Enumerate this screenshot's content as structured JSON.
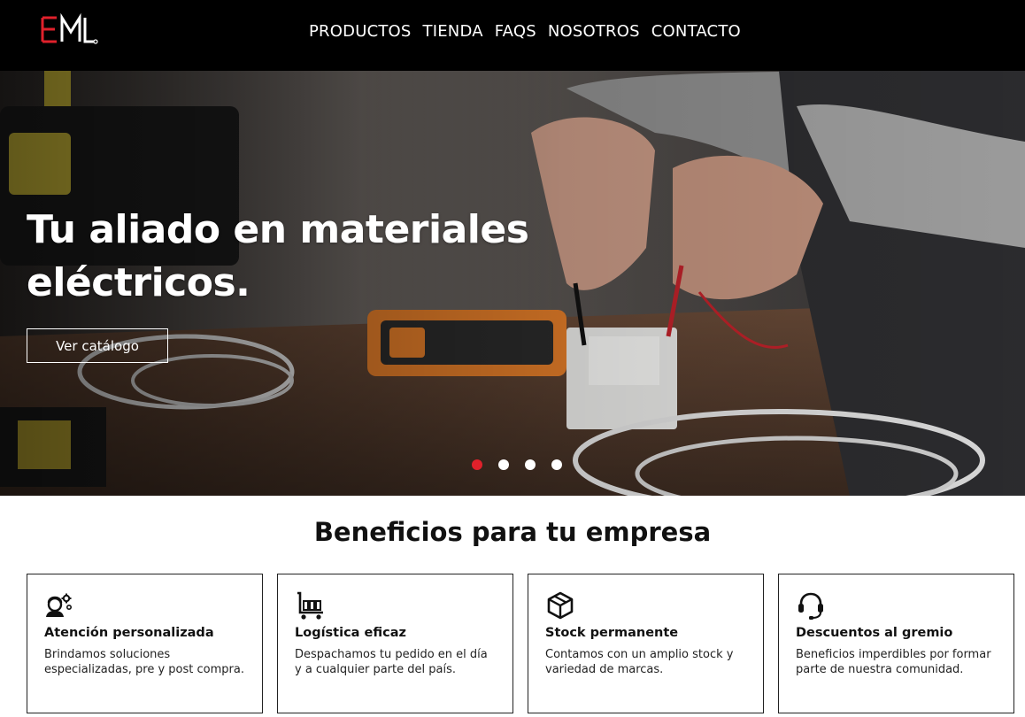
{
  "header": {
    "logo_text": "EML",
    "nav": [
      "PRODUCTOS",
      "TIENDA",
      "FAQS",
      "NOSOTROS",
      "CONTACTO"
    ]
  },
  "hero": {
    "title": "Tu aliado en materiales eléctricos.",
    "button_label": "Ver catálogo",
    "slides_count": 4,
    "active_slide": 1
  },
  "benefits": {
    "title": "Beneficios para tu empresa",
    "cards": [
      {
        "icon": "support-gears-icon",
        "title": "Atención personalizada",
        "text": "Brindamos soluciones especializadas, pre y post compra."
      },
      {
        "icon": "cart-icon",
        "title": "Logística eficaz",
        "text": "Despachamos tu pedido en el día y a cualquier parte del país."
      },
      {
        "icon": "box-icon",
        "title": "Stock permanente",
        "text": "Contamos con un amplio stock y variedad de marcas."
      },
      {
        "icon": "headset-icon",
        "title": "Descuentos al gremio",
        "text": "Beneficios imperdibles por formar parte de nuestra comunidad."
      }
    ]
  },
  "colors": {
    "accent": "#e0212b",
    "header_bg": "#000000"
  }
}
